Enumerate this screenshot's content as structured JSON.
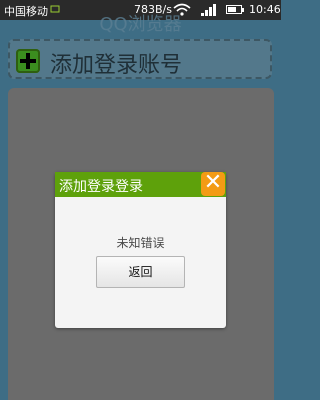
{
  "status_bar": {
    "carrier": "中国移动",
    "network_speed": "783B/s",
    "time": "10:46"
  },
  "app": {
    "title": "QQ浏览器",
    "add_account_label": "添加登录账号"
  },
  "dialog": {
    "title": "添加登录登录",
    "message": "未知错误",
    "back_button_label": "返回",
    "close_glyph": "✕"
  },
  "colors": {
    "background": "#3e6d85",
    "dialog_header": "#5ea10b",
    "close_button": "#f39b14",
    "panel": "#6b6b6b"
  }
}
